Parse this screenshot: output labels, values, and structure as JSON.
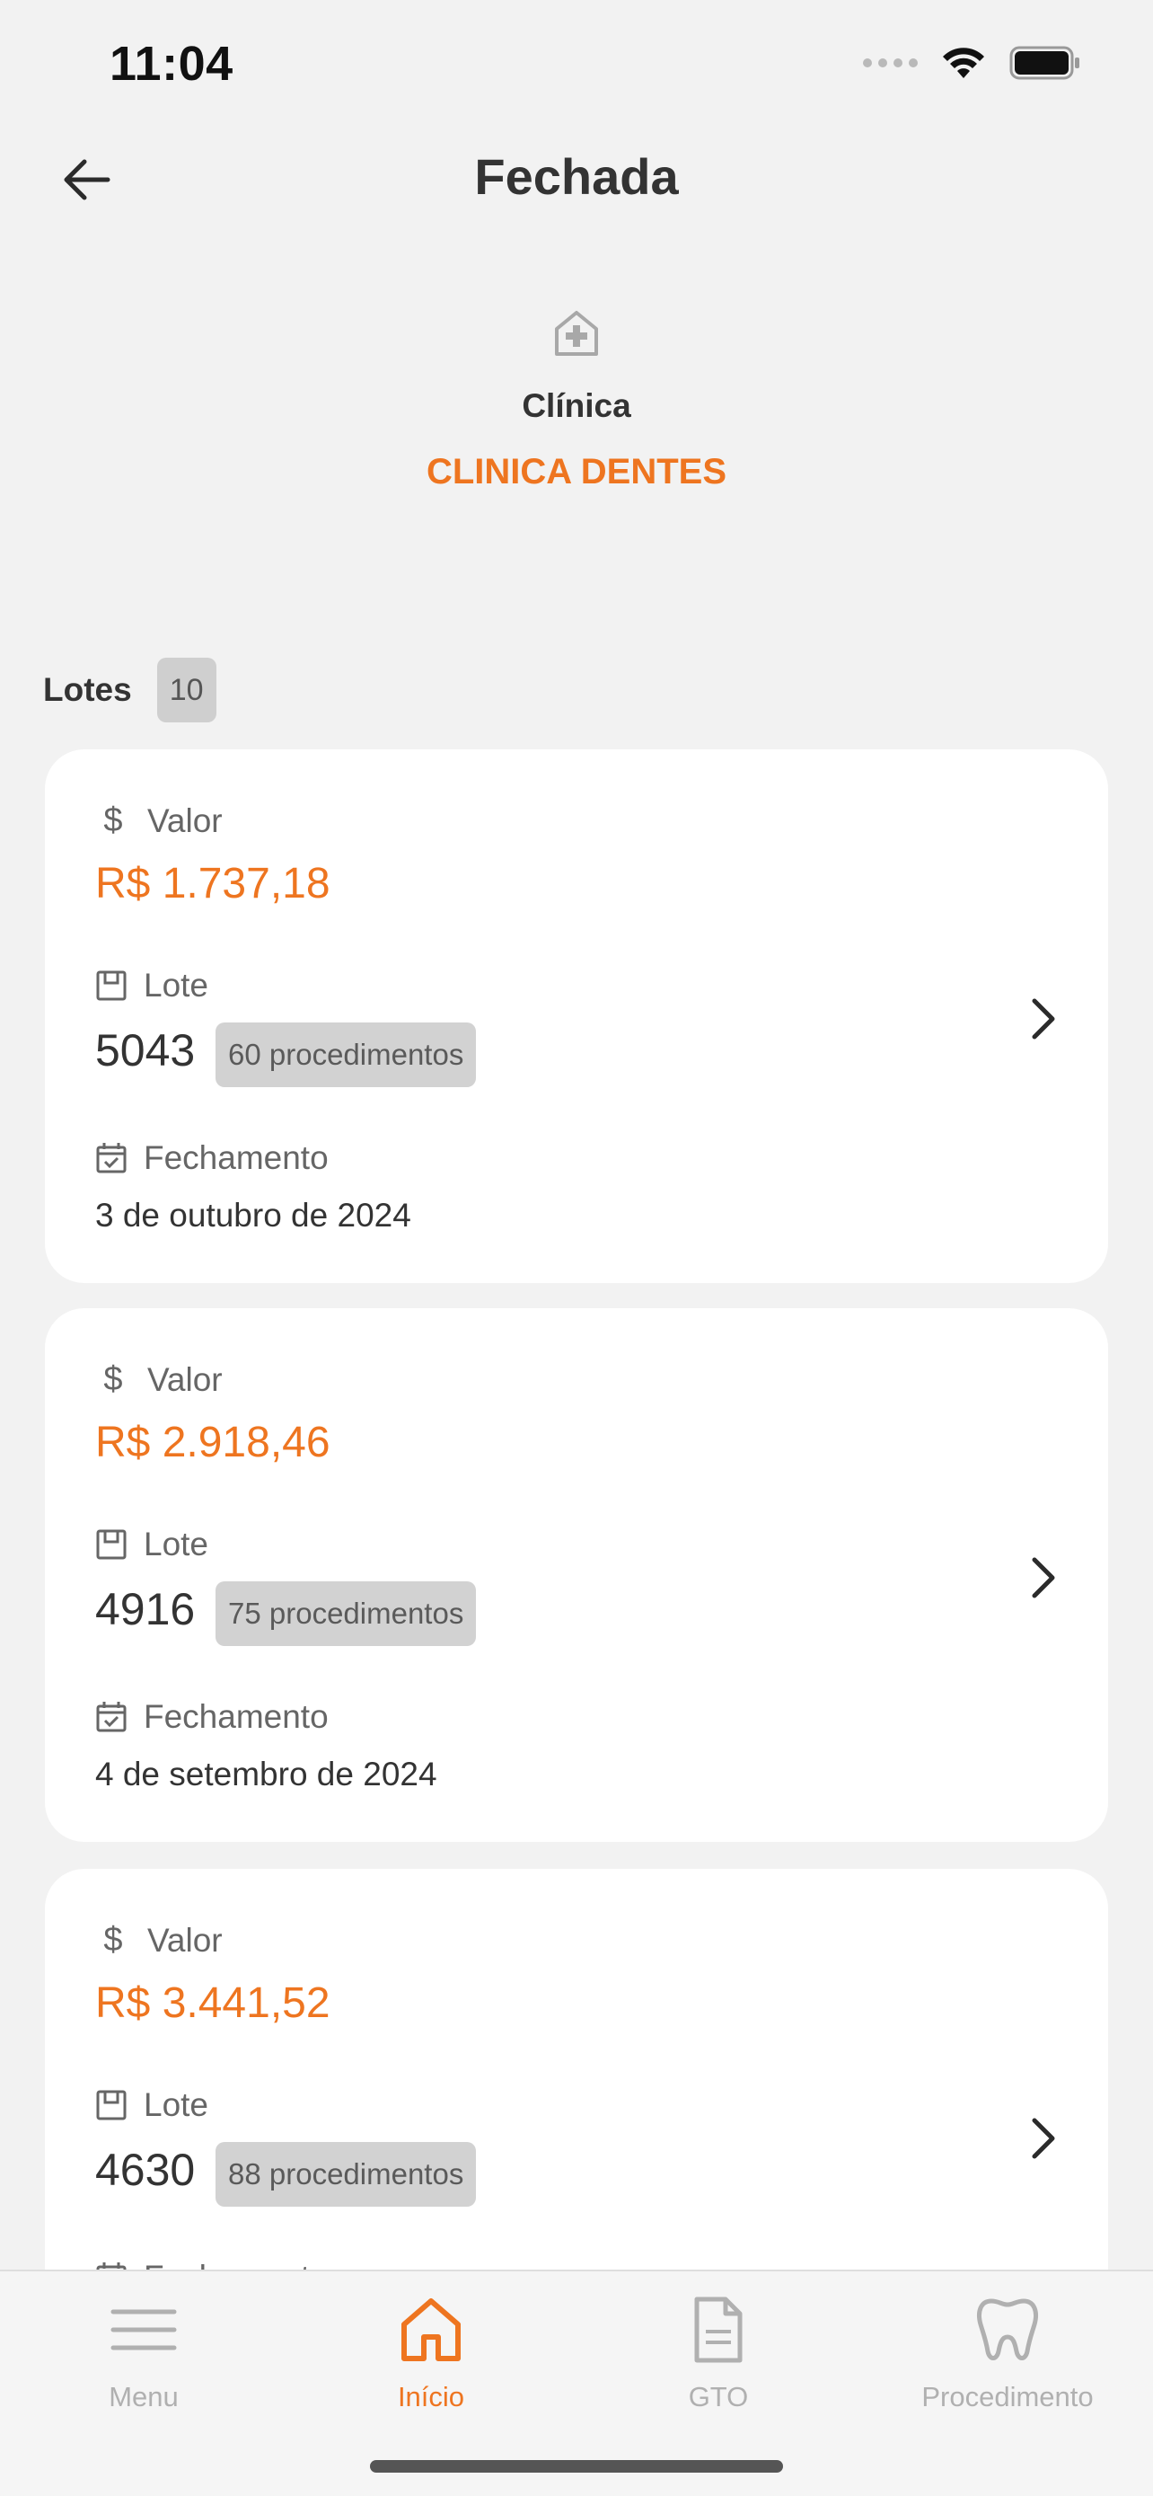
{
  "status_bar": {
    "time": "11:04",
    "signal_icon": "signal-icon",
    "wifi_icon": "wifi-icon",
    "battery_icon": "battery-icon"
  },
  "header": {
    "title": "Fechada",
    "back_icon": "arrow-left-icon"
  },
  "clinic": {
    "icon": "hospital-icon",
    "label": "Clínica",
    "name": "CLINICA DENTES"
  },
  "lotes": {
    "label": "Lotes",
    "count": "10"
  },
  "cards": [
    {
      "valor_label": "Valor",
      "valor": "R$ 1.737,18",
      "lote_label": "Lote",
      "lote": "5043",
      "procedimentos": "60 procedimentos",
      "fechamento_label": "Fechamento",
      "fechamento": "3 de outubro de 2024"
    },
    {
      "valor_label": "Valor",
      "valor": "R$ 2.918,46",
      "lote_label": "Lote",
      "lote": "4916",
      "procedimentos": "75 procedimentos",
      "fechamento_label": "Fechamento",
      "fechamento": "4 de setembro de 2024"
    },
    {
      "valor_label": "Valor",
      "valor": "R$ 3.441,52",
      "lote_label": "Lote",
      "lote": "4630",
      "procedimentos": "88 procedimentos",
      "fechamento_label": "Fechamento",
      "fechamento": ""
    }
  ],
  "tabs": [
    {
      "label": "Menu",
      "icon": "menu-icon",
      "active": false
    },
    {
      "label": "Início",
      "icon": "home-icon",
      "active": true
    },
    {
      "label": "GTO",
      "icon": "document-icon",
      "active": false
    },
    {
      "label": "Procedimento",
      "icon": "tooth-icon",
      "active": false
    }
  ],
  "colors": {
    "accent": "#ee7520",
    "background": "#f2f2f2",
    "card": "#ffffff",
    "badge": "#d2d2d2"
  }
}
